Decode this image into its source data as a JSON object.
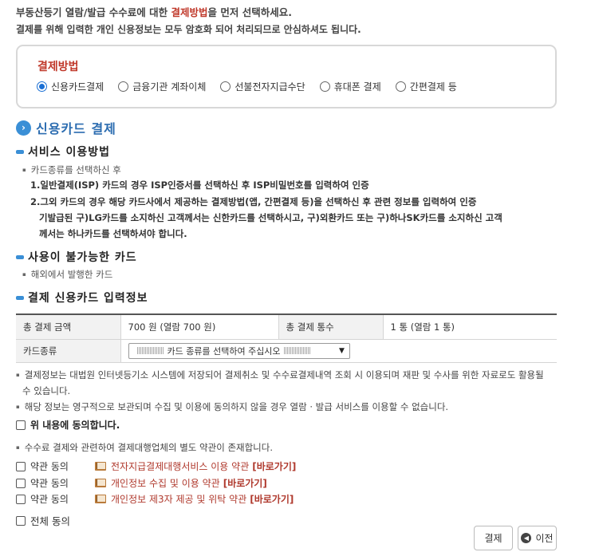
{
  "intro": {
    "line1_pre": "부동산등기 열람/발급 수수료에 대한 ",
    "line1_em": "결제방법",
    "line1_post": "을 먼저 선택하세요.",
    "line2": "결제를 위해 입력한 개인 신용정보는 모두 암호화 되어 처리되므로 안심하셔도 됩니다."
  },
  "payment": {
    "title": "결제방법",
    "options": [
      {
        "label": "신용카드결제",
        "checked": true
      },
      {
        "label": "금융기관 계좌이체",
        "checked": false
      },
      {
        "label": "선불전자지급수단",
        "checked": false
      },
      {
        "label": "휴대폰 결제",
        "checked": false
      },
      {
        "label": "간편결제 등",
        "checked": false
      }
    ]
  },
  "section_title": "신용카드 결제",
  "usage": {
    "heading": "서비스 이용방법",
    "bullet": "카드종류를 선택하신 후",
    "step1": "1.일반결제(ISP) 카드의 경우 ISP인증서를 선택하신 후 ISP비밀번호를 입력하여 인증",
    "step2_l1": "2.그외 카드의 경우 해당 카드사에서 제공하는 결제방법(앱, 간편결제 등)을 선택하신 후 관련 정보를 입력하여 인증",
    "step2_l2": "기발급된 구)LG카드를 소지하신 고객께서는 신한카드를 선택하시고, 구)외환카드 또는 구)하나SK카드를 소지하신 고객",
    "step2_l3": "께서는 하나카드를 선택하셔야 합니다."
  },
  "unusable": {
    "heading": "사용이 불가능한 카드",
    "bullet": "해외에서 발행한 카드"
  },
  "card_info": {
    "heading": "결제 신용카드 입력정보",
    "total_amount_label": "총 결제 금액",
    "total_amount_value": "700 원 (열람 700 원)",
    "total_count_label": "총 결제 통수",
    "total_count_value": "1 통 (열람 1 통)",
    "card_type_label": "카드종류",
    "card_type_placeholder": "카드 종류를 선택하여 주십시오"
  },
  "notes": {
    "n1_l1": "결제정보는 대법원 인터넷등기소 시스템에 저장되어 결제취소 및 수수료결제내역 조회 시 이용되며 재판 및 수사를 위한 자료로도 활용될",
    "n1_l2": "수 있습니다.",
    "n2": "해당 정보는 영구적으로 보관되며 수집 및 이용에 동의하지 않을 경우 열람 · 발급 서비스를 이용할 수 없습니다.",
    "agree_above": "위 내용에 동의합니다.",
    "n3": "수수료 결제와 관련하여 결제대행업체의 별도 약관이 존재합니다."
  },
  "terms": [
    {
      "agree_label": "약관 동의",
      "title": "전자지급결제대행서비스 이용 약관",
      "link": "[바로가기]"
    },
    {
      "agree_label": "약관 동의",
      "title": "개인정보 수집 및 이용 약관",
      "link": "[바로가기]"
    },
    {
      "agree_label": "약관 동의",
      "title": "개인정보 제3자 제공 및 위탁 약관",
      "link": "[바로가기]"
    }
  ],
  "agree_all": "전체 동의",
  "buttons": {
    "pay": "결제",
    "prev": "이전"
  },
  "colors": {
    "accent_red": "#c0392b",
    "accent_blue": "#2b6cb0",
    "radio_blue": "#1a6fd4"
  },
  "icons": {
    "section": "chevron-right-icon",
    "book": "book-icon",
    "prev": "back-arrow-icon"
  }
}
